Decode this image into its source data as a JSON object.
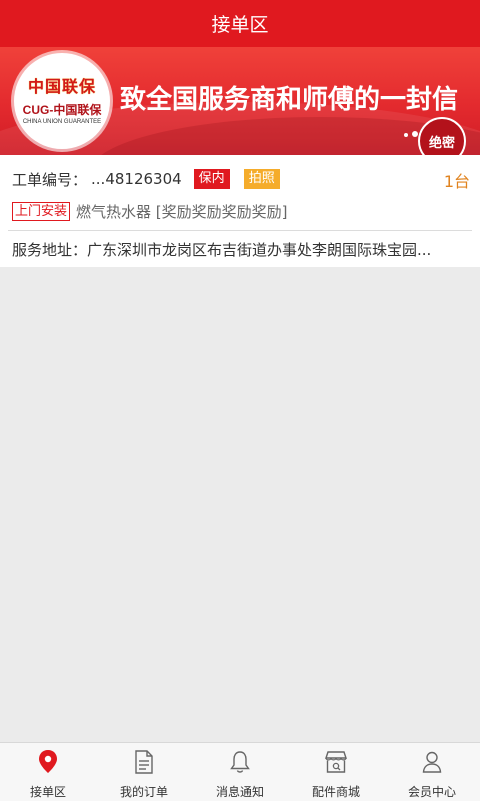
{
  "header": {
    "title": "接单区"
  },
  "banner": {
    "logo_cn": "中国联保",
    "logo_en": "CUG-中国联保",
    "logo_sub": "CHINA UNION GUARANTEE",
    "title": "致全国服务商和师傅的一封信",
    "seal": "绝密"
  },
  "order": {
    "id_label": "工单编号：",
    "id_value": "...48126304",
    "tag_warranty": "保内",
    "tag_photo": "拍照",
    "quantity": "1台",
    "service_type": "上门安装",
    "product": "燃气热水器 [奖励奖励奖励奖励]",
    "address": "服务地址：广东深圳市龙岗区布吉街道办事处李朗国际珠宝园..."
  },
  "tabs": [
    {
      "label": "接单区",
      "icon": "location-pin-icon"
    },
    {
      "label": "我的订单",
      "icon": "document-icon"
    },
    {
      "label": "消息通知",
      "icon": "bell-icon"
    },
    {
      "label": "配件商城",
      "icon": "store-icon"
    },
    {
      "label": "会员中心",
      "icon": "user-icon"
    }
  ],
  "colors": {
    "primary": "#e0191f",
    "orange": "#f5ac2b",
    "qty": "#e0831f"
  }
}
